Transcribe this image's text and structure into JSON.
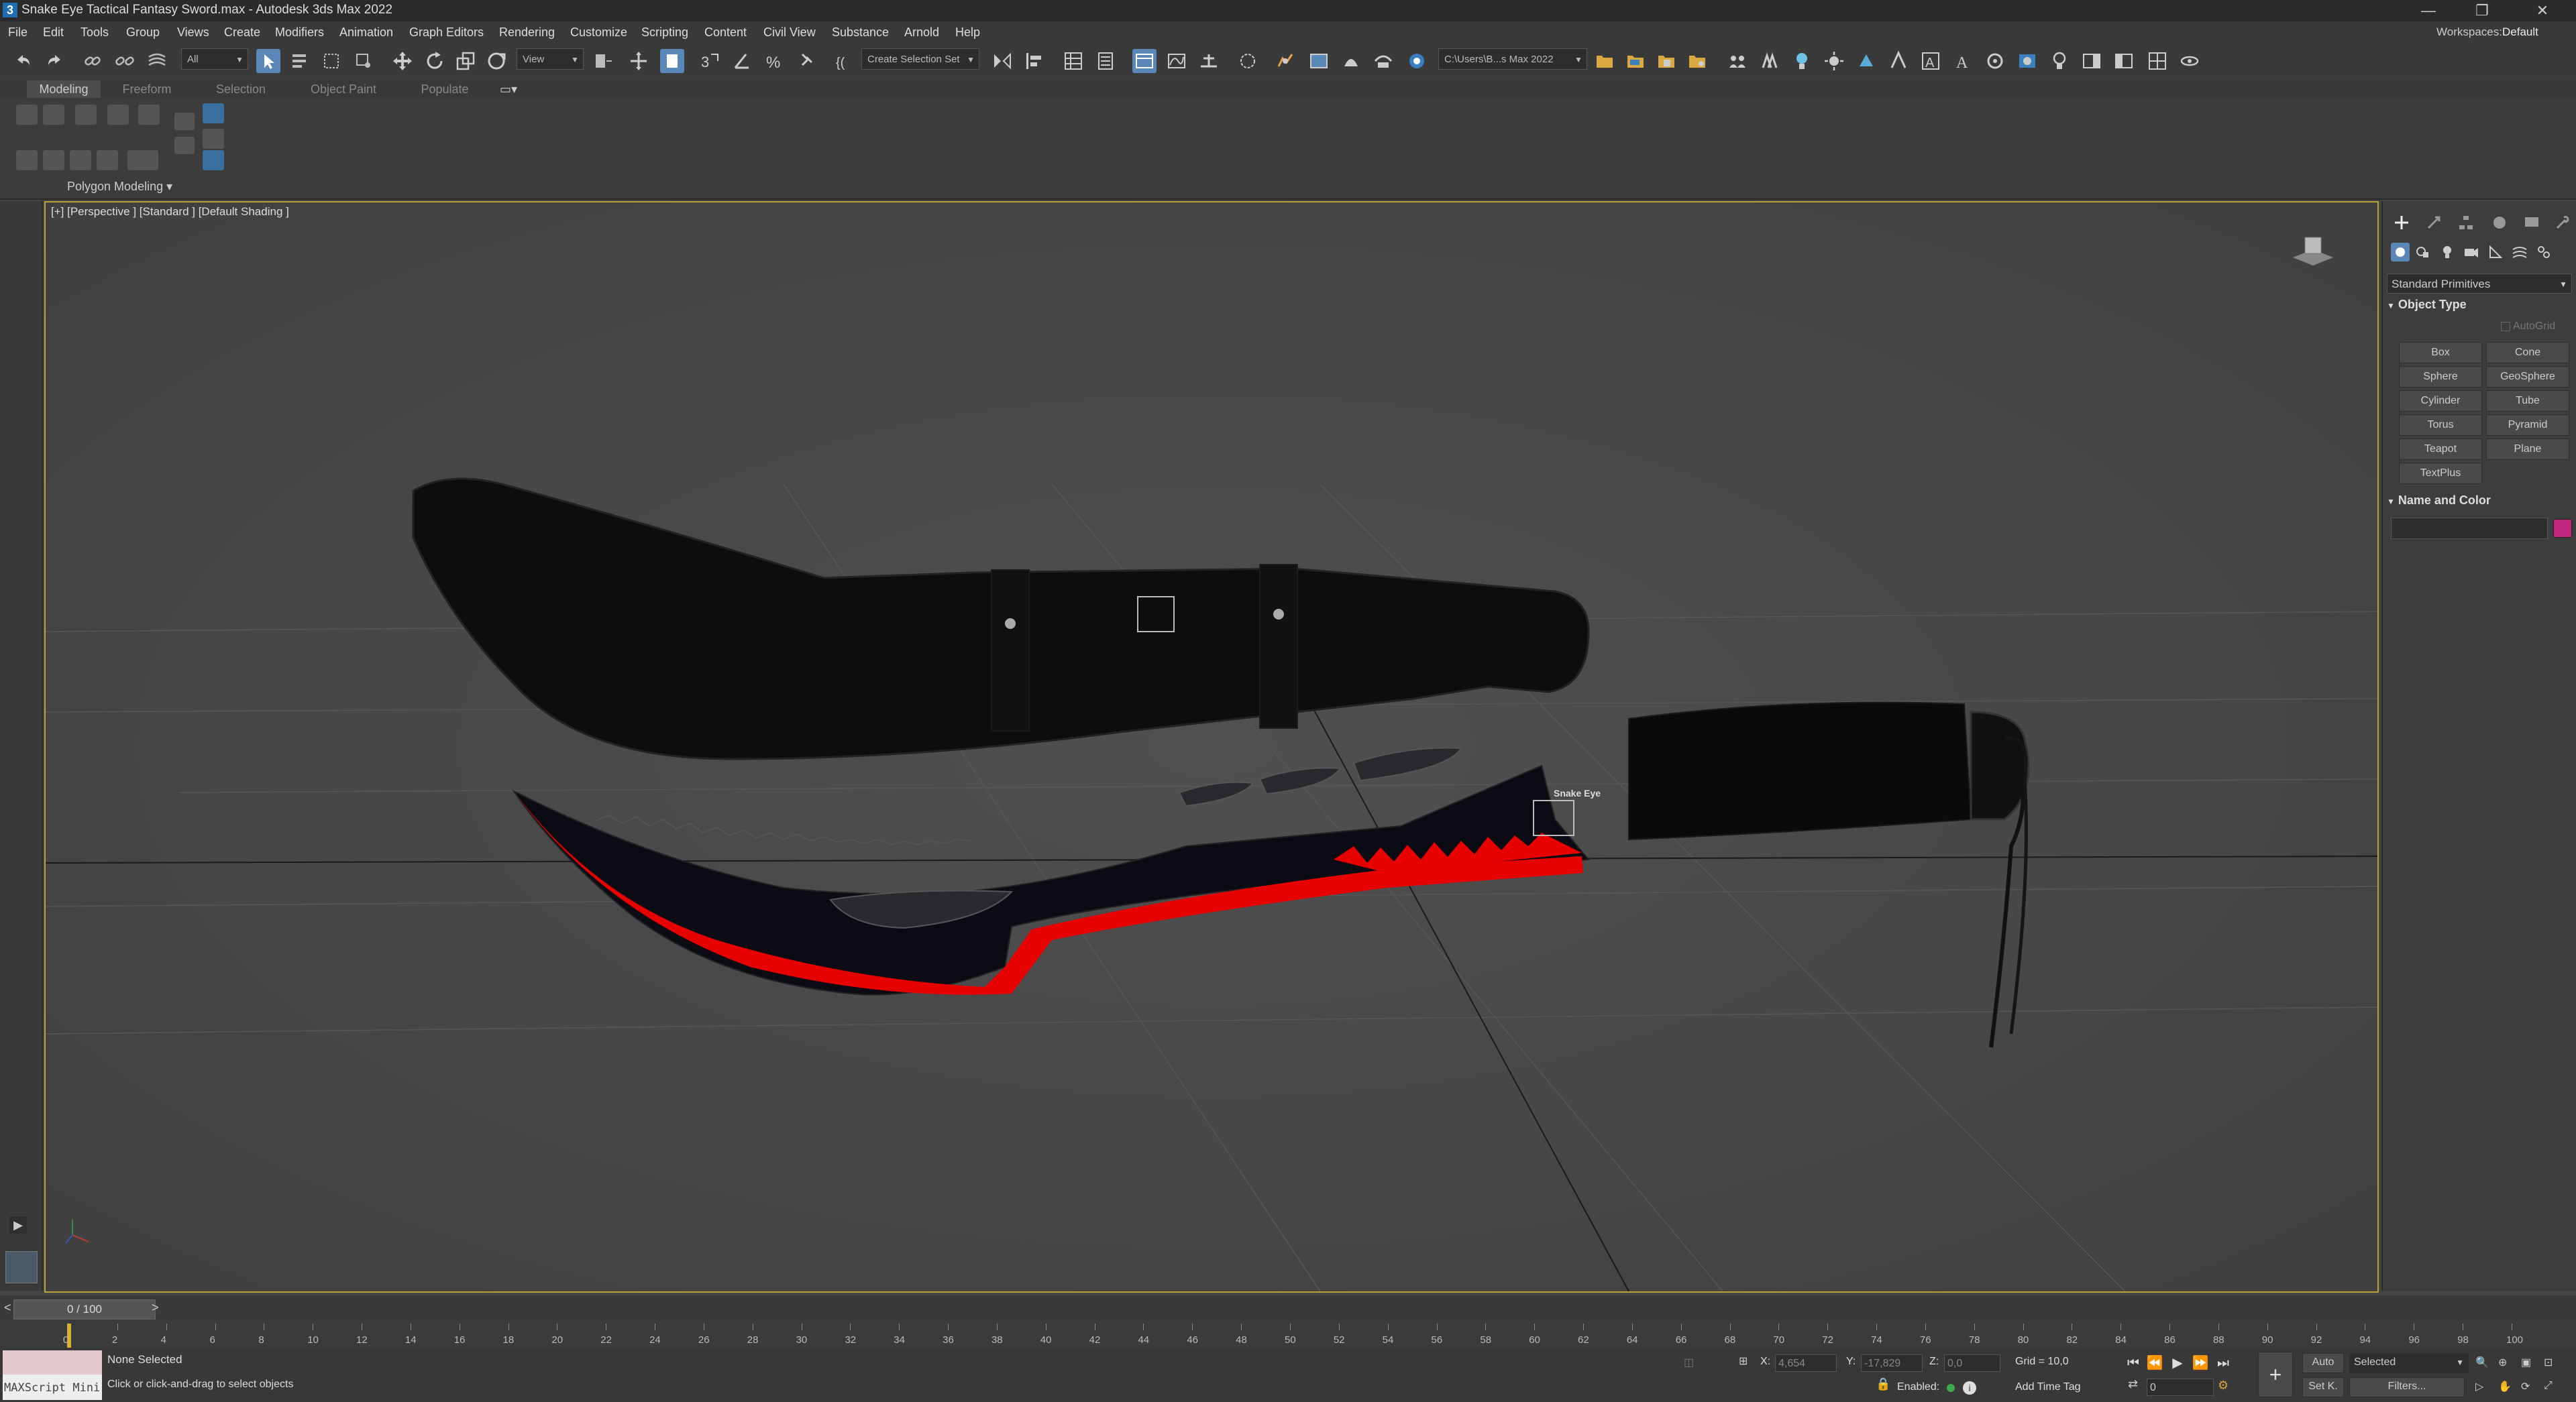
{
  "window": {
    "title": "Snake Eye Tactical Fantasy Sword.max - Autodesk 3ds Max 2022",
    "minimize": "—",
    "maximize": "❐",
    "close": "✕"
  },
  "menu": {
    "items": [
      "File",
      "Edit",
      "Tools",
      "Group",
      "Views",
      "Create",
      "Modifiers",
      "Animation",
      "Graph Editors",
      "Rendering",
      "Customize",
      "Scripting",
      "Content",
      "Civil View",
      "Substance",
      "Arnold",
      "Help"
    ],
    "workspaces_label": "Workspaces:",
    "workspaces_value": "Default"
  },
  "toolbar": {
    "selection_filter": "All",
    "reference_coord": "View",
    "named_selection": "Create Selection Set",
    "project_path": "C:\\Users\\B...s Max 2022"
  },
  "ribbon": {
    "tabs": [
      "Modeling",
      "Freeform",
      "Selection",
      "Object Paint",
      "Populate"
    ],
    "active_tab": "Modeling",
    "panel_label": "Polygon Modeling",
    "panel_toggle": "▾"
  },
  "viewport": {
    "label": "[+] [Perspective ] [Standard ] [Default Shading ]",
    "logo_text": "Snake Eye",
    "colors": {
      "blade_edge": "#e60000",
      "blade_body": "#0b0b12",
      "sheath": "#0e0e0e"
    }
  },
  "command_panel": {
    "category": "Standard Primitives",
    "object_type_title": "Object Type",
    "autogrid": "AutoGrid",
    "primitives": [
      "Box",
      "Cone",
      "Sphere",
      "GeoSphere",
      "Cylinder",
      "Tube",
      "Torus",
      "Pyramid",
      "Teapot",
      "Plane",
      "TextPlus"
    ],
    "name_color_title": "Name and Color",
    "object_color": "#c2287e"
  },
  "timeline": {
    "frame_display": "0 / 100",
    "ticks": [
      0,
      2,
      4,
      6,
      8,
      10,
      12,
      14,
      16,
      18,
      20,
      22,
      24,
      26,
      28,
      30,
      32,
      34,
      36,
      38,
      40,
      42,
      44,
      46,
      48,
      50,
      52,
      54,
      56,
      58,
      60,
      62,
      64,
      66,
      68,
      70,
      72,
      74,
      76,
      78,
      80,
      82,
      84,
      86,
      88,
      90,
      92,
      94,
      96,
      98,
      100
    ],
    "prev": "<",
    "next": ">"
  },
  "status": {
    "maxscript_label": "MAXScript Mini",
    "selection_status": "None Selected",
    "prompt": "Click or click-and-drag to select objects",
    "x_label": "X:",
    "x_value": "4,654",
    "y_label": "Y:",
    "y_value": "-17,829",
    "z_label": "Z:",
    "z_value": "0,0",
    "grid": "Grid = 10,0",
    "enabled_label": "Enabled:",
    "add_time_tag": "Add Time Tag",
    "auto_key": "Auto",
    "set_key": "Set K.",
    "key_filter": "Selected",
    "filters": "Filters...",
    "current_frame": "0"
  }
}
